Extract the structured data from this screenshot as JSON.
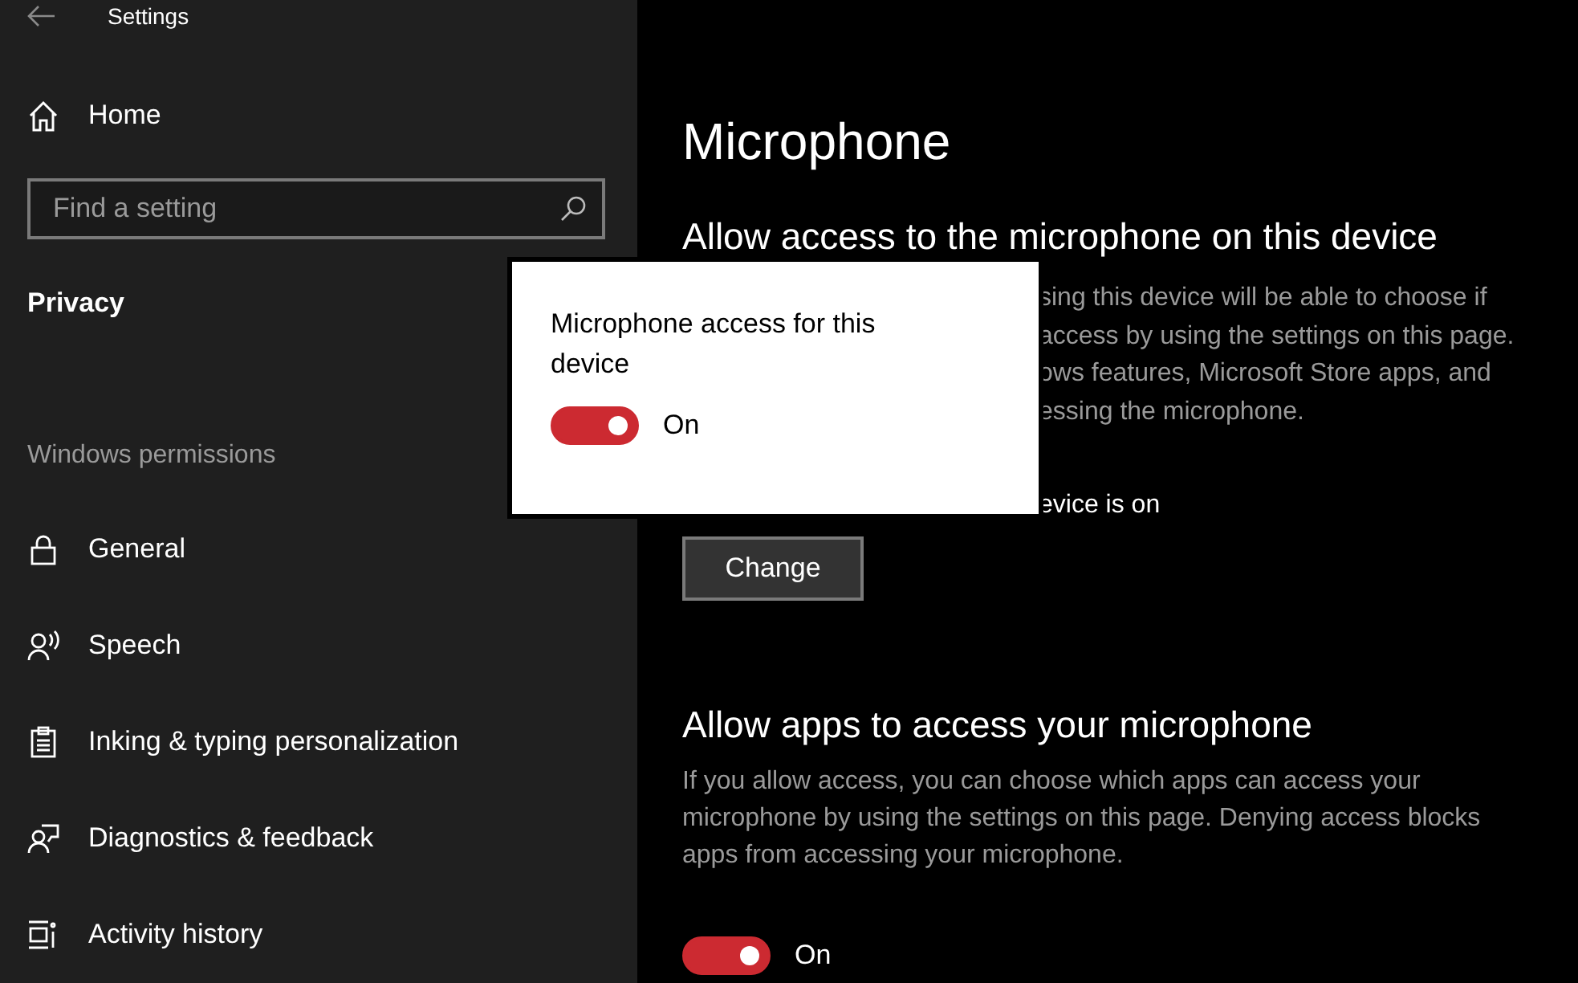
{
  "window": {
    "title": "Settings"
  },
  "sidebar": {
    "home": "Home",
    "search": {
      "placeholder": "Find a setting"
    },
    "section": "Privacy",
    "group": "Windows permissions",
    "items": [
      {
        "label": "General",
        "kind": "lock"
      },
      {
        "label": "Speech",
        "kind": "speech"
      },
      {
        "label": "Inking & typing personalization",
        "kind": "clipboard"
      },
      {
        "label": "Diagnostics & feedback",
        "kind": "feedback"
      },
      {
        "label": "Activity history",
        "kind": "activity"
      }
    ]
  },
  "main": {
    "title": "Microphone",
    "device_section": {
      "heading": "Allow access to the microphone on this device",
      "description_fragments": [
        "sing this device will be able to choose if",
        "access by using the settings on this page.",
        "ows features, Microsoft Store apps, and",
        "essing the microphone."
      ],
      "status_fragment": "evice is on",
      "button": "Change"
    },
    "apps_section": {
      "heading": "Allow apps to access your microphone",
      "description": "If you allow access, you can choose which apps can access your microphone by using the settings on this page. Denying access blocks apps from accessing your microphone.",
      "toggle": {
        "on": true,
        "label": "On"
      }
    }
  },
  "popup": {
    "label": "Microphone access for this device",
    "toggle": {
      "on": true,
      "label": "On"
    }
  }
}
